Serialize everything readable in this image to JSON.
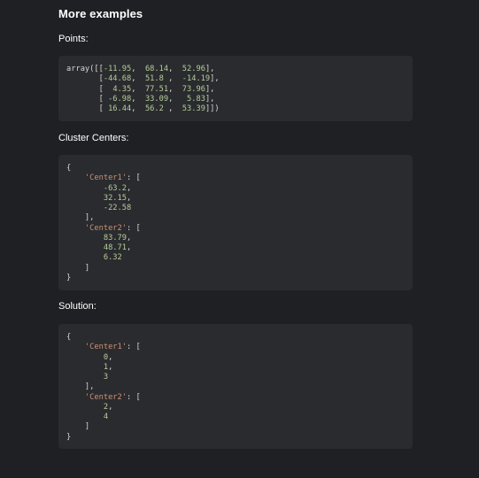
{
  "heading": "More examples",
  "sections": {
    "points": {
      "label": "Points:",
      "lines": [
        [
          [
            "txt",
            "array([["
          ],
          [
            "num",
            "-11.95"
          ],
          [
            "pun",
            ",  "
          ],
          [
            "num",
            "68.14"
          ],
          [
            "pun",
            ",  "
          ],
          [
            "num",
            "52.96"
          ],
          [
            "pun",
            "],"
          ]
        ],
        [
          [
            "txt",
            "       ["
          ],
          [
            "num",
            "-44.68"
          ],
          [
            "pun",
            ",  "
          ],
          [
            "num",
            "51.8"
          ],
          [
            "pun",
            " ,  "
          ],
          [
            "num",
            "-14.19"
          ],
          [
            "pun",
            "],"
          ]
        ],
        [
          [
            "txt",
            "       [  "
          ],
          [
            "num",
            "4.35"
          ],
          [
            "pun",
            ",  "
          ],
          [
            "num",
            "77.51"
          ],
          [
            "pun",
            ",  "
          ],
          [
            "num",
            "73.96"
          ],
          [
            "pun",
            "],"
          ]
        ],
        [
          [
            "txt",
            "       [ "
          ],
          [
            "num",
            "-6.98"
          ],
          [
            "pun",
            ",  "
          ],
          [
            "num",
            "33.09"
          ],
          [
            "pun",
            ",   "
          ],
          [
            "num",
            "5.83"
          ],
          [
            "pun",
            "],"
          ]
        ],
        [
          [
            "txt",
            "       [ "
          ],
          [
            "num",
            "16.44"
          ],
          [
            "pun",
            ",  "
          ],
          [
            "num",
            "56.2"
          ],
          [
            "pun",
            " ,  "
          ],
          [
            "num",
            "53.39"
          ],
          [
            "pun",
            "]])"
          ]
        ]
      ]
    },
    "centers": {
      "label": "Cluster Centers:",
      "lines": [
        [
          [
            "pun",
            "{"
          ]
        ],
        [
          [
            "pun",
            "    "
          ],
          [
            "str",
            "'Center1'"
          ],
          [
            "pun",
            ": ["
          ]
        ],
        [
          [
            "pun",
            "        "
          ],
          [
            "num",
            "-63.2"
          ],
          [
            "pun",
            ","
          ]
        ],
        [
          [
            "pun",
            "        "
          ],
          [
            "num",
            "32.15"
          ],
          [
            "pun",
            ","
          ]
        ],
        [
          [
            "pun",
            "        "
          ],
          [
            "num",
            "-22.58"
          ]
        ],
        [
          [
            "pun",
            "    ],"
          ]
        ],
        [
          [
            "pun",
            "    "
          ],
          [
            "str",
            "'Center2'"
          ],
          [
            "pun",
            ": ["
          ]
        ],
        [
          [
            "pun",
            "        "
          ],
          [
            "num",
            "83.79"
          ],
          [
            "pun",
            ","
          ]
        ],
        [
          [
            "pun",
            "        "
          ],
          [
            "num",
            "48.71"
          ],
          [
            "pun",
            ","
          ]
        ],
        [
          [
            "pun",
            "        "
          ],
          [
            "num",
            "6.32"
          ]
        ],
        [
          [
            "pun",
            "    ]"
          ]
        ],
        [
          [
            "pun",
            "}"
          ]
        ]
      ]
    },
    "solution": {
      "label": "Solution:",
      "lines": [
        [
          [
            "pun",
            "{"
          ]
        ],
        [
          [
            "pun",
            "    "
          ],
          [
            "str",
            "'Center1'"
          ],
          [
            "pun",
            ": ["
          ]
        ],
        [
          [
            "pun",
            "        "
          ],
          [
            "num",
            "0"
          ],
          [
            "pun",
            ","
          ]
        ],
        [
          [
            "pun",
            "        "
          ],
          [
            "num",
            "1"
          ],
          [
            "pun",
            ","
          ]
        ],
        [
          [
            "pun",
            "        "
          ],
          [
            "num",
            "3"
          ]
        ],
        [
          [
            "pun",
            "    ],"
          ]
        ],
        [
          [
            "pun",
            "    "
          ],
          [
            "str",
            "'Center2'"
          ],
          [
            "pun",
            ": ["
          ]
        ],
        [
          [
            "pun",
            "        "
          ],
          [
            "num",
            "2"
          ],
          [
            "pun",
            ","
          ]
        ],
        [
          [
            "pun",
            "        "
          ],
          [
            "num",
            "4"
          ]
        ],
        [
          [
            "pun",
            "    ]"
          ]
        ],
        [
          [
            "pun",
            "}"
          ]
        ]
      ]
    }
  }
}
